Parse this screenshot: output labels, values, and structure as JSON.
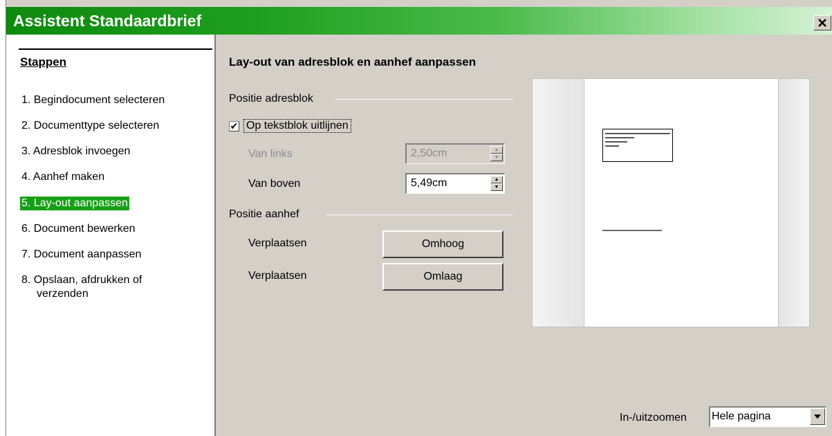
{
  "window": {
    "title": "Assistent Standaardbrief",
    "close_icon": "close-icon"
  },
  "sidebar": {
    "heading": "Stappen",
    "items": [
      {
        "label": "1. Begindocument selecteren",
        "active": false
      },
      {
        "label": "2. Documenttype selecteren",
        "active": false
      },
      {
        "label": "3. Adresblok invoegen",
        "active": false
      },
      {
        "label": "4. Aanhef maken",
        "active": false
      },
      {
        "label": "5. Lay-out aanpassen",
        "active": true
      },
      {
        "label": "6. Document bewerken",
        "active": false
      },
      {
        "label": "7. Document aanpassen",
        "active": false
      },
      {
        "label": "8. Opslaan, afdrukken of",
        "label2": "verzenden",
        "active": false
      }
    ]
  },
  "main": {
    "title": "Lay-out van adresblok en aanhef aanpassen",
    "address_group": {
      "label": "Positie adresblok",
      "align_checkbox_label": "Op tekstblok uitlijnen",
      "align_checked": true,
      "from_left_label": "Van links",
      "from_left_value": "2,50cm",
      "from_left_enabled": false,
      "from_top_label": "Van boven",
      "from_top_value": "5,49cm"
    },
    "salutation_group": {
      "label": "Positie aanhef",
      "move_up_label": "Verplaatsen",
      "move_up_button": "Omhoog",
      "move_down_label": "Verplaatsen",
      "move_down_button": "Omlaag"
    },
    "zoom": {
      "label": "In-/uitzoomen",
      "value": "Hele pagina"
    }
  },
  "colors": {
    "titlebar_start": "#0e8a0e",
    "active_step": "#16a016",
    "dialog_bg": "#d4d0c8"
  }
}
